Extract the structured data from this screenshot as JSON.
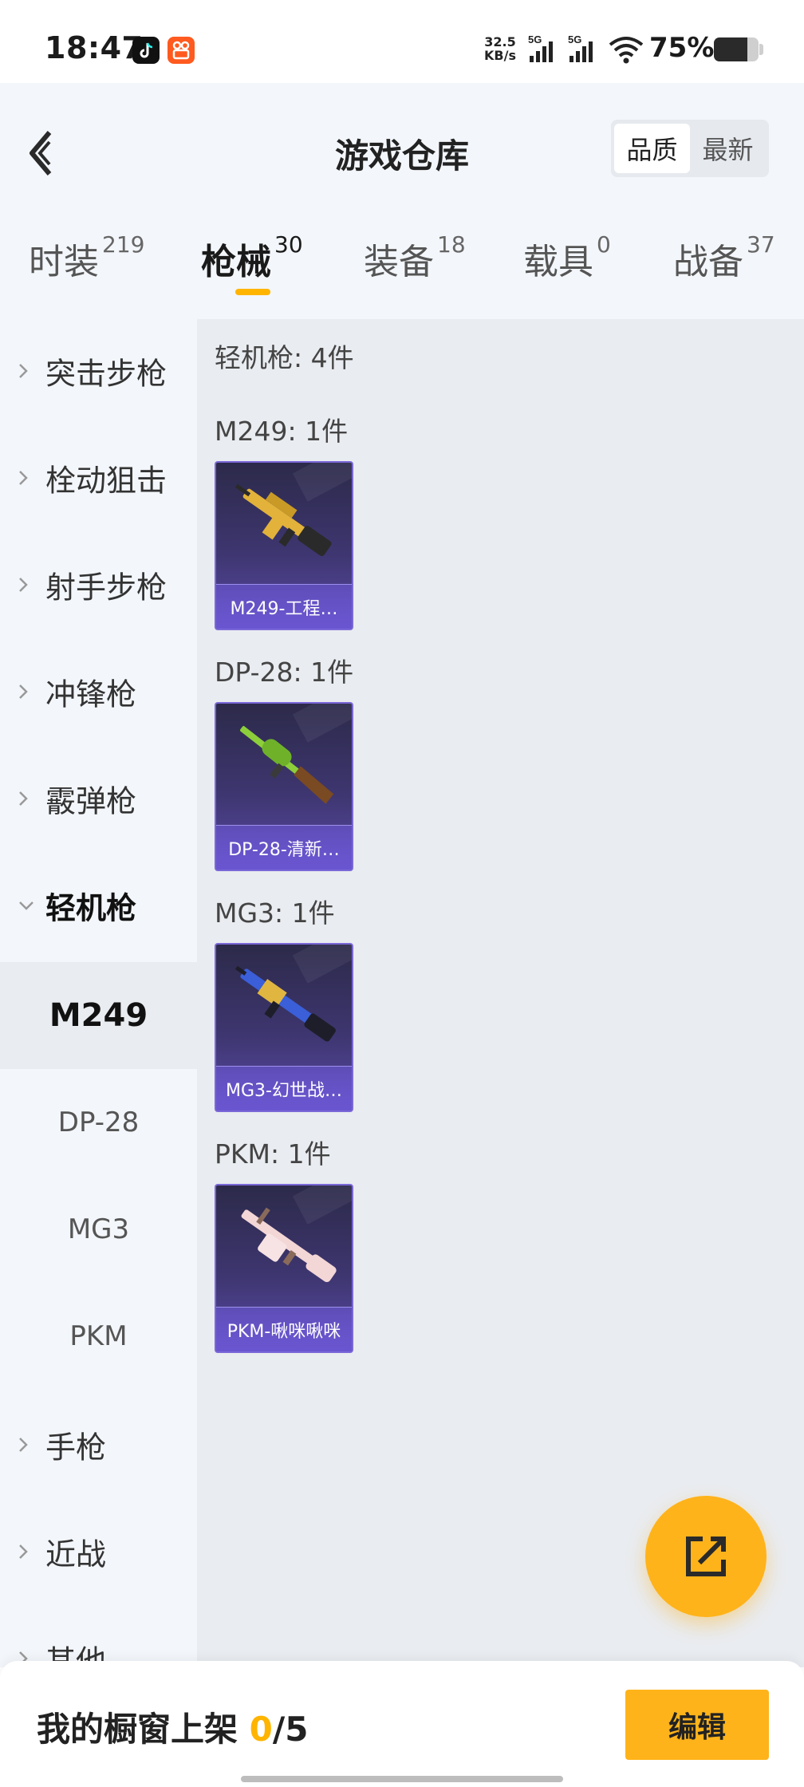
{
  "status_bar": {
    "time": "18:47",
    "net_speed_value": "32.5",
    "net_speed_unit": "KB/s",
    "signal_1_label": "5G",
    "signal_2_label": "5G",
    "battery_percent": "75%",
    "battery_level": 0.75,
    "icons": [
      "tiktok-icon",
      "kuaishou-icon",
      "signal-icon",
      "wifi-icon",
      "battery-icon"
    ]
  },
  "header": {
    "back_icon": "back-arrow-icon",
    "title": "游戏仓库",
    "sort_options": [
      {
        "label": "品质",
        "active": true
      },
      {
        "label": "最新",
        "active": false
      }
    ]
  },
  "tabs": [
    {
      "label": "时装",
      "count": "219",
      "active": false
    },
    {
      "label": "枪械",
      "count": "30",
      "active": true
    },
    {
      "label": "装备",
      "count": "18",
      "active": false
    },
    {
      "label": "载具",
      "count": "0",
      "active": false
    },
    {
      "label": "战备",
      "count": "37",
      "active": false
    }
  ],
  "sidebar": {
    "categories": [
      {
        "label": "突击步枪",
        "open": false
      },
      {
        "label": "栓动狙击",
        "open": false
      },
      {
        "label": "射手步枪",
        "open": false
      },
      {
        "label": "冲锋枪",
        "open": false
      },
      {
        "label": "霰弹枪",
        "open": false
      },
      {
        "label": "轻机枪",
        "open": true
      },
      {
        "label": "手枪",
        "open": false
      },
      {
        "label": "近战",
        "open": false
      },
      {
        "label": "其他",
        "open": false
      }
    ],
    "subitems": [
      {
        "label": "M249",
        "active": true
      },
      {
        "label": "DP-28",
        "active": false
      },
      {
        "label": "MG3",
        "active": false
      },
      {
        "label": "PKM",
        "active": false
      }
    ]
  },
  "content": {
    "summary": "轻机枪: 4件",
    "groups": [
      {
        "title": "M249: 1件",
        "item_name": "M249-工程…",
        "gun_colors": [
          "#e2b23a",
          "#2a2a2a"
        ]
      },
      {
        "title": "DP-28: 1件",
        "item_name": "DP-28-清新…",
        "gun_colors": [
          "#8ccf3a",
          "#7a4a22"
        ]
      },
      {
        "title": "MG3: 1件",
        "item_name": "MG3-幻世战…",
        "gun_colors": [
          "#3a5fd8",
          "#e0b640"
        ]
      },
      {
        "title": "PKM: 1件",
        "item_name": "PKM-啾咪啾咪",
        "gun_colors": [
          "#f3d6d6",
          "#8a6a5a"
        ]
      }
    ]
  },
  "fab": {
    "icon": "share-external-icon"
  },
  "footer": {
    "showcase_label": "我的橱窗上架",
    "showcase_current": "0",
    "showcase_total": "/5",
    "edit_label": "编辑"
  },
  "colors": {
    "accent": "#ffb400",
    "card_purple": "#5a4aa8",
    "sidebar_bg": "#f3f6fa",
    "content_bg": "#e9ecf0"
  }
}
